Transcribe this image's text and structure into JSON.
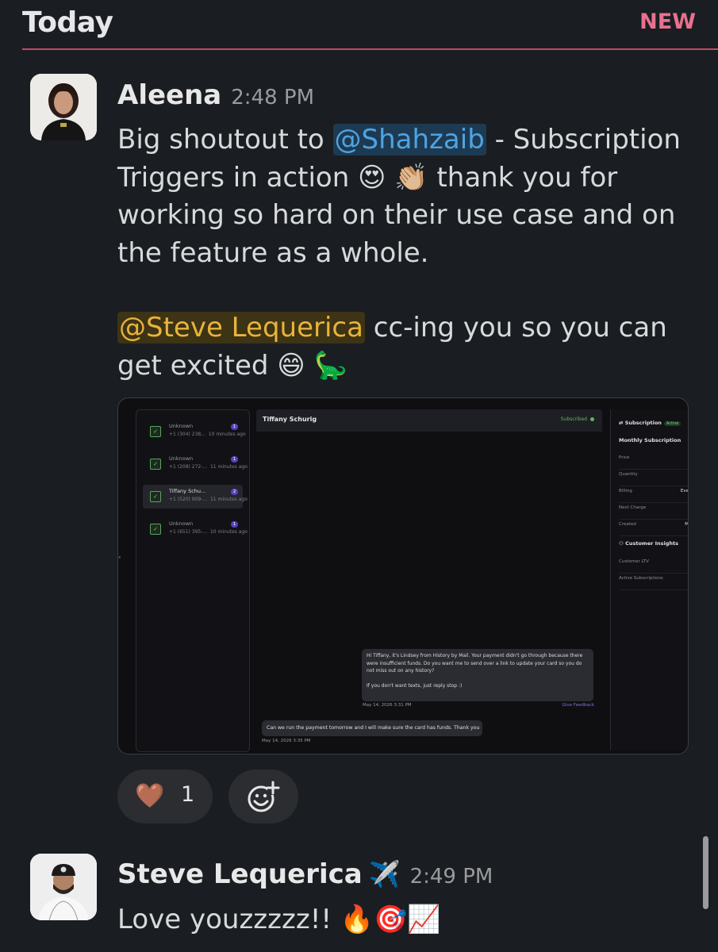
{
  "header": {
    "day": "Today",
    "new_label": "NEW"
  },
  "messages": [
    {
      "sender": "Aleena",
      "time": "2:48 PM",
      "body": {
        "intro": "Big shoutout to ",
        "mention1": "@Shahzaib",
        "after_mention1": " - Subscription Triggers in action ",
        "emoji_heart_eyes": "😍",
        "emoji_clap": "👏🏼",
        "continuation": " thank you for working so hard on their use case and on the feature as a whole.",
        "mention2": "@Steve Lequerica",
        "after_mention2": " cc-ing you so you can get excited ",
        "emoji_grin": "😄",
        "emoji_dino": "🦕"
      },
      "attachment": {
        "conversations": [
          {
            "name": "Unknown",
            "phone": "+1 (304) 238...",
            "time": "10 minutes ago",
            "badge": "1"
          },
          {
            "name": "Unknown",
            "phone": "+1 (208) 272-...",
            "time": "11 minutes ago",
            "badge": "1"
          },
          {
            "name": "Tiffany Schu...",
            "phone": "+1 (520) 909-...",
            "time": "11 minutes ago",
            "badge": "2"
          },
          {
            "name": "Unknown",
            "phone": "+1 (651) 395-...",
            "time": "10 minutes ago",
            "badge": "1"
          }
        ],
        "contact_name": "Tiffany Schurig",
        "status": "Subscribed",
        "outgoing_text_1": "Hi Tiffany, it's Lindsey from History by Mail. Your payment didn't go through because there were insufficient funds. Do you want me to send over a link to update your card so you do not miss out on any history?",
        "outgoing_text_2": "If you don't want texts, just reply stop :)",
        "outgoing_time": "May 14, 2026 3:31 PM",
        "feedback_link": "Give Feedback",
        "incoming_text": "Can we run the payment tomorrow and I will make sure the card has funds. Thank you",
        "incoming_time": "May 14, 2026 3:35 PM",
        "panel": {
          "title": "Subscription",
          "active_badge": "Active",
          "subscription_name": "Monthly Subscription",
          "rows": [
            {
              "label": "Price",
              "value": ""
            },
            {
              "label": "Quantity",
              "value": ""
            },
            {
              "label": "Billing",
              "value": "Eve"
            },
            {
              "label": "Next Charge",
              "value": ""
            },
            {
              "label": "Created",
              "value": "M"
            }
          ],
          "insights_title": "Customer Insights",
          "insight_rows": [
            {
              "label": "Customer LTV"
            },
            {
              "label": "Active Subscriptions"
            }
          ]
        }
      },
      "reactions": [
        {
          "emoji": "🤎",
          "count": "1"
        }
      ]
    },
    {
      "sender": "Steve Lequerica",
      "status_emoji": "✈️",
      "time": "2:49 PM",
      "body": "Love youzzzzz!! 🔥🎯📈"
    }
  ],
  "colors": {
    "background": "#1a1d21",
    "new_divider": "#c64a6b",
    "mention_blue": "#4fa3e0",
    "mention_yellow": "#e8b33c"
  },
  "icons": {
    "collapse": "‹",
    "check": "✓",
    "subscription": "⇄",
    "person": "⚇"
  }
}
